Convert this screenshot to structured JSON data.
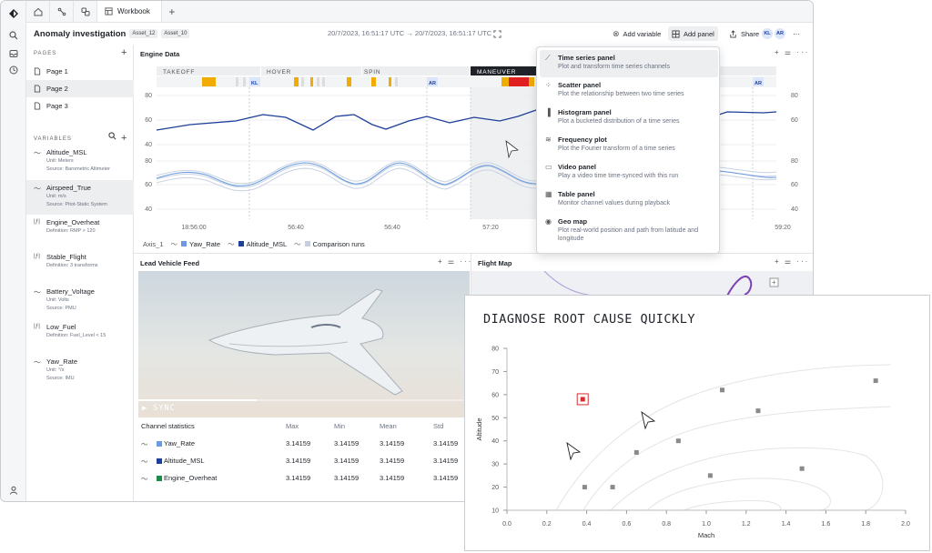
{
  "tabs": {
    "workbook_label": "Workbook",
    "add_tab": "+"
  },
  "header": {
    "title": "Anomaly investigation",
    "assets": [
      "Asset_12",
      "Asset_10"
    ],
    "time_start": "20/7/2023, 16:51:17 UTC",
    "arrow": "→",
    "time_end": "20/7/2023, 16:51:17 UTC",
    "add_variable": "Add variable",
    "add_panel": "Add panel",
    "share": "Share",
    "avatars": [
      "KL",
      "AR"
    ],
    "more": "···"
  },
  "sidebar": {
    "pages_title": "PAGES",
    "pages": [
      "Page 1",
      "Page 2",
      "Page 3"
    ],
    "selected_page": 1,
    "variables_title": "VARIABLES",
    "variables": [
      {
        "name": "Altitude_MSL",
        "line1": "Unit: Meters",
        "line2": "Source: Barometric Altimeter",
        "icon": "trend-icon"
      },
      {
        "name": "Airspeed_True",
        "line1": "Unit: m/s",
        "line2": "Source: Pitot-Static System",
        "icon": "trend-icon"
      },
      {
        "name": "Engine_Overheat",
        "line1": "Definition: RMP > 120",
        "line2": "",
        "icon": "formula-icon"
      },
      {
        "name": "Stable_Flight",
        "line1": "Definition: 3 transforms",
        "line2": "",
        "icon": "formula-icon"
      },
      {
        "name": "Battery_Voltage",
        "line1": "Unit: Volts",
        "line2": "Source: PMU",
        "icon": "trend-icon"
      },
      {
        "name": "Low_Fuel",
        "line1": "Definition: Fuel_Level < 15",
        "line2": "",
        "icon": "formula-icon"
      },
      {
        "name": "Yaw_Rate",
        "line1": "Unit: °/s",
        "line2": "Source: IMU",
        "icon": "trend-icon"
      }
    ],
    "selected_variable": 1
  },
  "engine_panel": {
    "title": "Engine Data",
    "phases": [
      "TAKEOFF",
      "HOVER",
      "SPIN",
      "MANEUVER"
    ],
    "markers": [
      "KL",
      "AR",
      "AR"
    ],
    "y_ticks_upper": [
      "80",
      "60",
      "40"
    ],
    "y_ticks_lower": [
      "80",
      "60",
      "40"
    ],
    "y_ticks_right": [
      "80",
      "60",
      "80",
      "60",
      "40"
    ],
    "x_ticks": [
      "18:56:00",
      "56:40",
      "56:40",
      "57:20",
      "59:20"
    ],
    "legend_axis": "Axis_1",
    "legend": [
      {
        "label": "Yaw_Rate",
        "color": "#6a9be0"
      },
      {
        "label": "Altitude_MSL",
        "color": "#1d3f9a"
      },
      {
        "label": "Comparison runs",
        "color": "#c6cfdb"
      }
    ]
  },
  "menu": {
    "items": [
      {
        "title": "Time series panel",
        "desc": "Plot and transform time series channels",
        "icon": "line-chart-icon"
      },
      {
        "title": "Scatter panel",
        "desc": "Plot the relationship between two time series",
        "icon": "scatter-icon"
      },
      {
        "title": "Histogram panel",
        "desc": "Plot a bucketed distribution of a time series",
        "icon": "histogram-icon"
      },
      {
        "title": "Frequency plot",
        "desc": "Plot the Fourier transform of a time series",
        "icon": "wave-icon"
      },
      {
        "title": "Video panel",
        "desc": "Play a video time time-synced with this run",
        "icon": "video-icon"
      },
      {
        "title": "Table panel",
        "desc": "Monitor channel values during playback",
        "icon": "table-icon"
      },
      {
        "title": "Geo map",
        "desc": "Plot real-world position and path from latitude and longitude",
        "icon": "pin-icon"
      }
    ],
    "highlighted": 0
  },
  "feed_panel": {
    "title": "Lead Vehicle Feed",
    "sync": "SYNC"
  },
  "map_panel": {
    "title": "Flight Map"
  },
  "stats": {
    "title": "Channel statistics",
    "headers": [
      "Max",
      "Min",
      "Mean",
      "Std"
    ],
    "rows": [
      {
        "name": "Yaw_Rate",
        "color": "#6a9be0",
        "values": [
          "3.14159",
          "3.14159",
          "3.14159",
          "3.14159"
        ]
      },
      {
        "name": "Altitude_MSL",
        "color": "#1d3f9a",
        "values": [
          "3.14159",
          "3.14159",
          "3.14159",
          "3.14159"
        ]
      },
      {
        "name": "Engine_Overheat",
        "color": "#1e8a4a",
        "values": [
          "3.14159",
          "3.14159",
          "3.14159",
          "3.14159"
        ]
      }
    ]
  },
  "overlay": {
    "title": "DIAGNOSE ROOT CAUSE QUICKLY"
  },
  "chart_data": {
    "type": "scatter",
    "title": "",
    "xlabel": "Mach",
    "ylabel": "Altitude",
    "xlim": [
      0.0,
      2.0
    ],
    "ylim": [
      10,
      80
    ],
    "x_ticks": [
      "0.0",
      "0.2",
      "0.4",
      "0.6",
      "0.8",
      "1.0",
      "1.2",
      "1.4",
      "1.6",
      "1.8",
      "2.0"
    ],
    "y_ticks": [
      "10",
      "20",
      "30",
      "40",
      "50",
      "60",
      "70",
      "80"
    ],
    "points": [
      {
        "x": 0.39,
        "y": 20
      },
      {
        "x": 0.53,
        "y": 20
      },
      {
        "x": 0.65,
        "y": 35
      },
      {
        "x": 0.86,
        "y": 40
      },
      {
        "x": 1.02,
        "y": 25
      },
      {
        "x": 1.08,
        "y": 62
      },
      {
        "x": 1.26,
        "y": 53
      },
      {
        "x": 1.48,
        "y": 28
      },
      {
        "x": 1.85,
        "y": 66
      }
    ],
    "highlight": {
      "x": 0.38,
      "y": 58
    },
    "colors": {
      "point": "#8a8a8a",
      "highlight": "#d62f2f"
    }
  }
}
